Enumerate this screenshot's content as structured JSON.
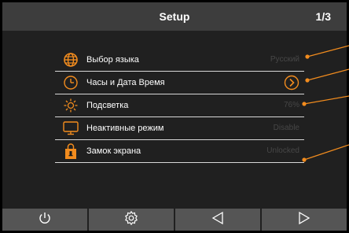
{
  "header": {
    "title": "Setup",
    "page": "1/3"
  },
  "menu": {
    "items": [
      {
        "label": "Выбор языка",
        "value": "Русский",
        "icon": "globe-icon"
      },
      {
        "label": "Часы и Дата Время",
        "value": "",
        "icon": "clock-icon"
      },
      {
        "label": "Подсветка",
        "value": "76%",
        "icon": "brightness-icon"
      },
      {
        "label": "Неактивные режим",
        "value": "Disable",
        "icon": "monitor-icon"
      },
      {
        "label": "Замок экрана",
        "value": "Unlocked",
        "icon": "lock-icon"
      }
    ]
  },
  "footer": {
    "buttons": [
      "power-icon",
      "settings-icon",
      "back-icon",
      "forward-icon"
    ]
  },
  "colors": {
    "accent": "#f28c1e",
    "header_bg": "#3d3d3d",
    "screen_bg": "#202020",
    "footer_bg": "#555555"
  }
}
